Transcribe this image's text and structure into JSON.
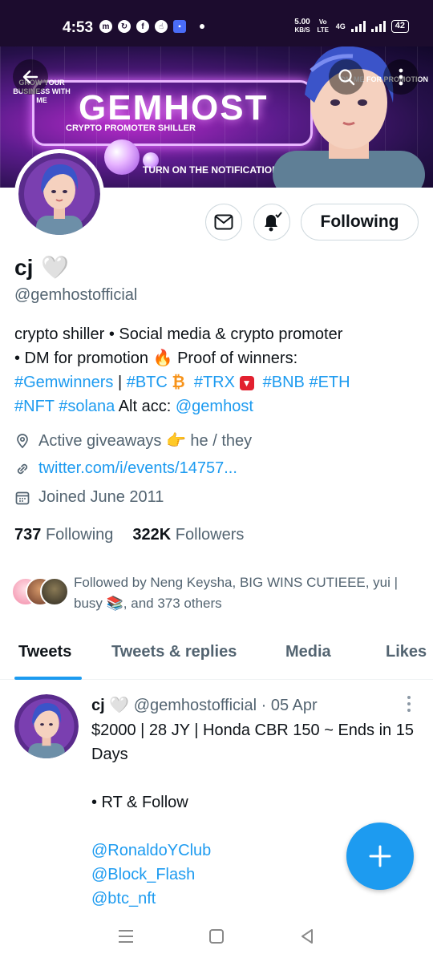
{
  "status_bar": {
    "time": "4:53",
    "net_speed": "5.00",
    "net_unit": "KB/S",
    "volte": "Vo LTE",
    "network": "4G",
    "battery": "42"
  },
  "banner": {
    "left_text": "GROW YOUR BUSINESS WITH ME",
    "logo": "GEMHOST",
    "subtitle": "CRYPTO PROMOTER   SHILLER",
    "notify": "TURN ON THE NOTIFICATION",
    "right_text": "DM ME FOR PROMOTION"
  },
  "profile": {
    "name": "cj",
    "handle": "@gemhostofficial",
    "following_button": "Following",
    "bio_line1": "crypto shiller • Social media & crypto promoter",
    "bio_line2a": "• DM for promotion ",
    "bio_line2b": " Proof of winners:",
    "hashtag_gemwinners": "#Gemwinners",
    "bio_sep": " | ",
    "hashtag_btc": "#BTC",
    "hashtag_trx": "#TRX",
    "hashtag_bnb": "#BNB",
    "hashtag_eth": "#ETH",
    "hashtag_nft": "#NFT",
    "hashtag_solana": "#solana",
    "alt_acc_label": " Alt acc: ",
    "alt_acc_handle": "@gemhost",
    "location": "Active giveaways",
    "pronouns": " he / they",
    "website": "twitter.com/i/events/14757...",
    "joined": "Joined June 2011",
    "following_count": "737",
    "following_label": "Following",
    "followers_count": "322K",
    "followers_label": "Followers",
    "followed_by": "Followed by Neng Keysha, BIG WINS CUTIEEE, yui | busy 📚, and 373 others"
  },
  "tabs": [
    "Tweets",
    "Tweets & replies",
    "Media",
    "Likes"
  ],
  "tweet": {
    "name": "cj",
    "handle": "@gemhostofficial",
    "date": "· 05 Apr",
    "line1": "$2000 | 28 JY | Honda CBR 150 ~ Ends in 15 Days",
    "line2": "• RT & Follow",
    "mention1": "@RonaldoYClub",
    "mention2": "@Block_Flash",
    "mention3": "@btc_nft"
  },
  "colors": {
    "accent": "#1d9bf0",
    "banner_bg": "#5c1c8d",
    "secondary_text": "#536471"
  }
}
